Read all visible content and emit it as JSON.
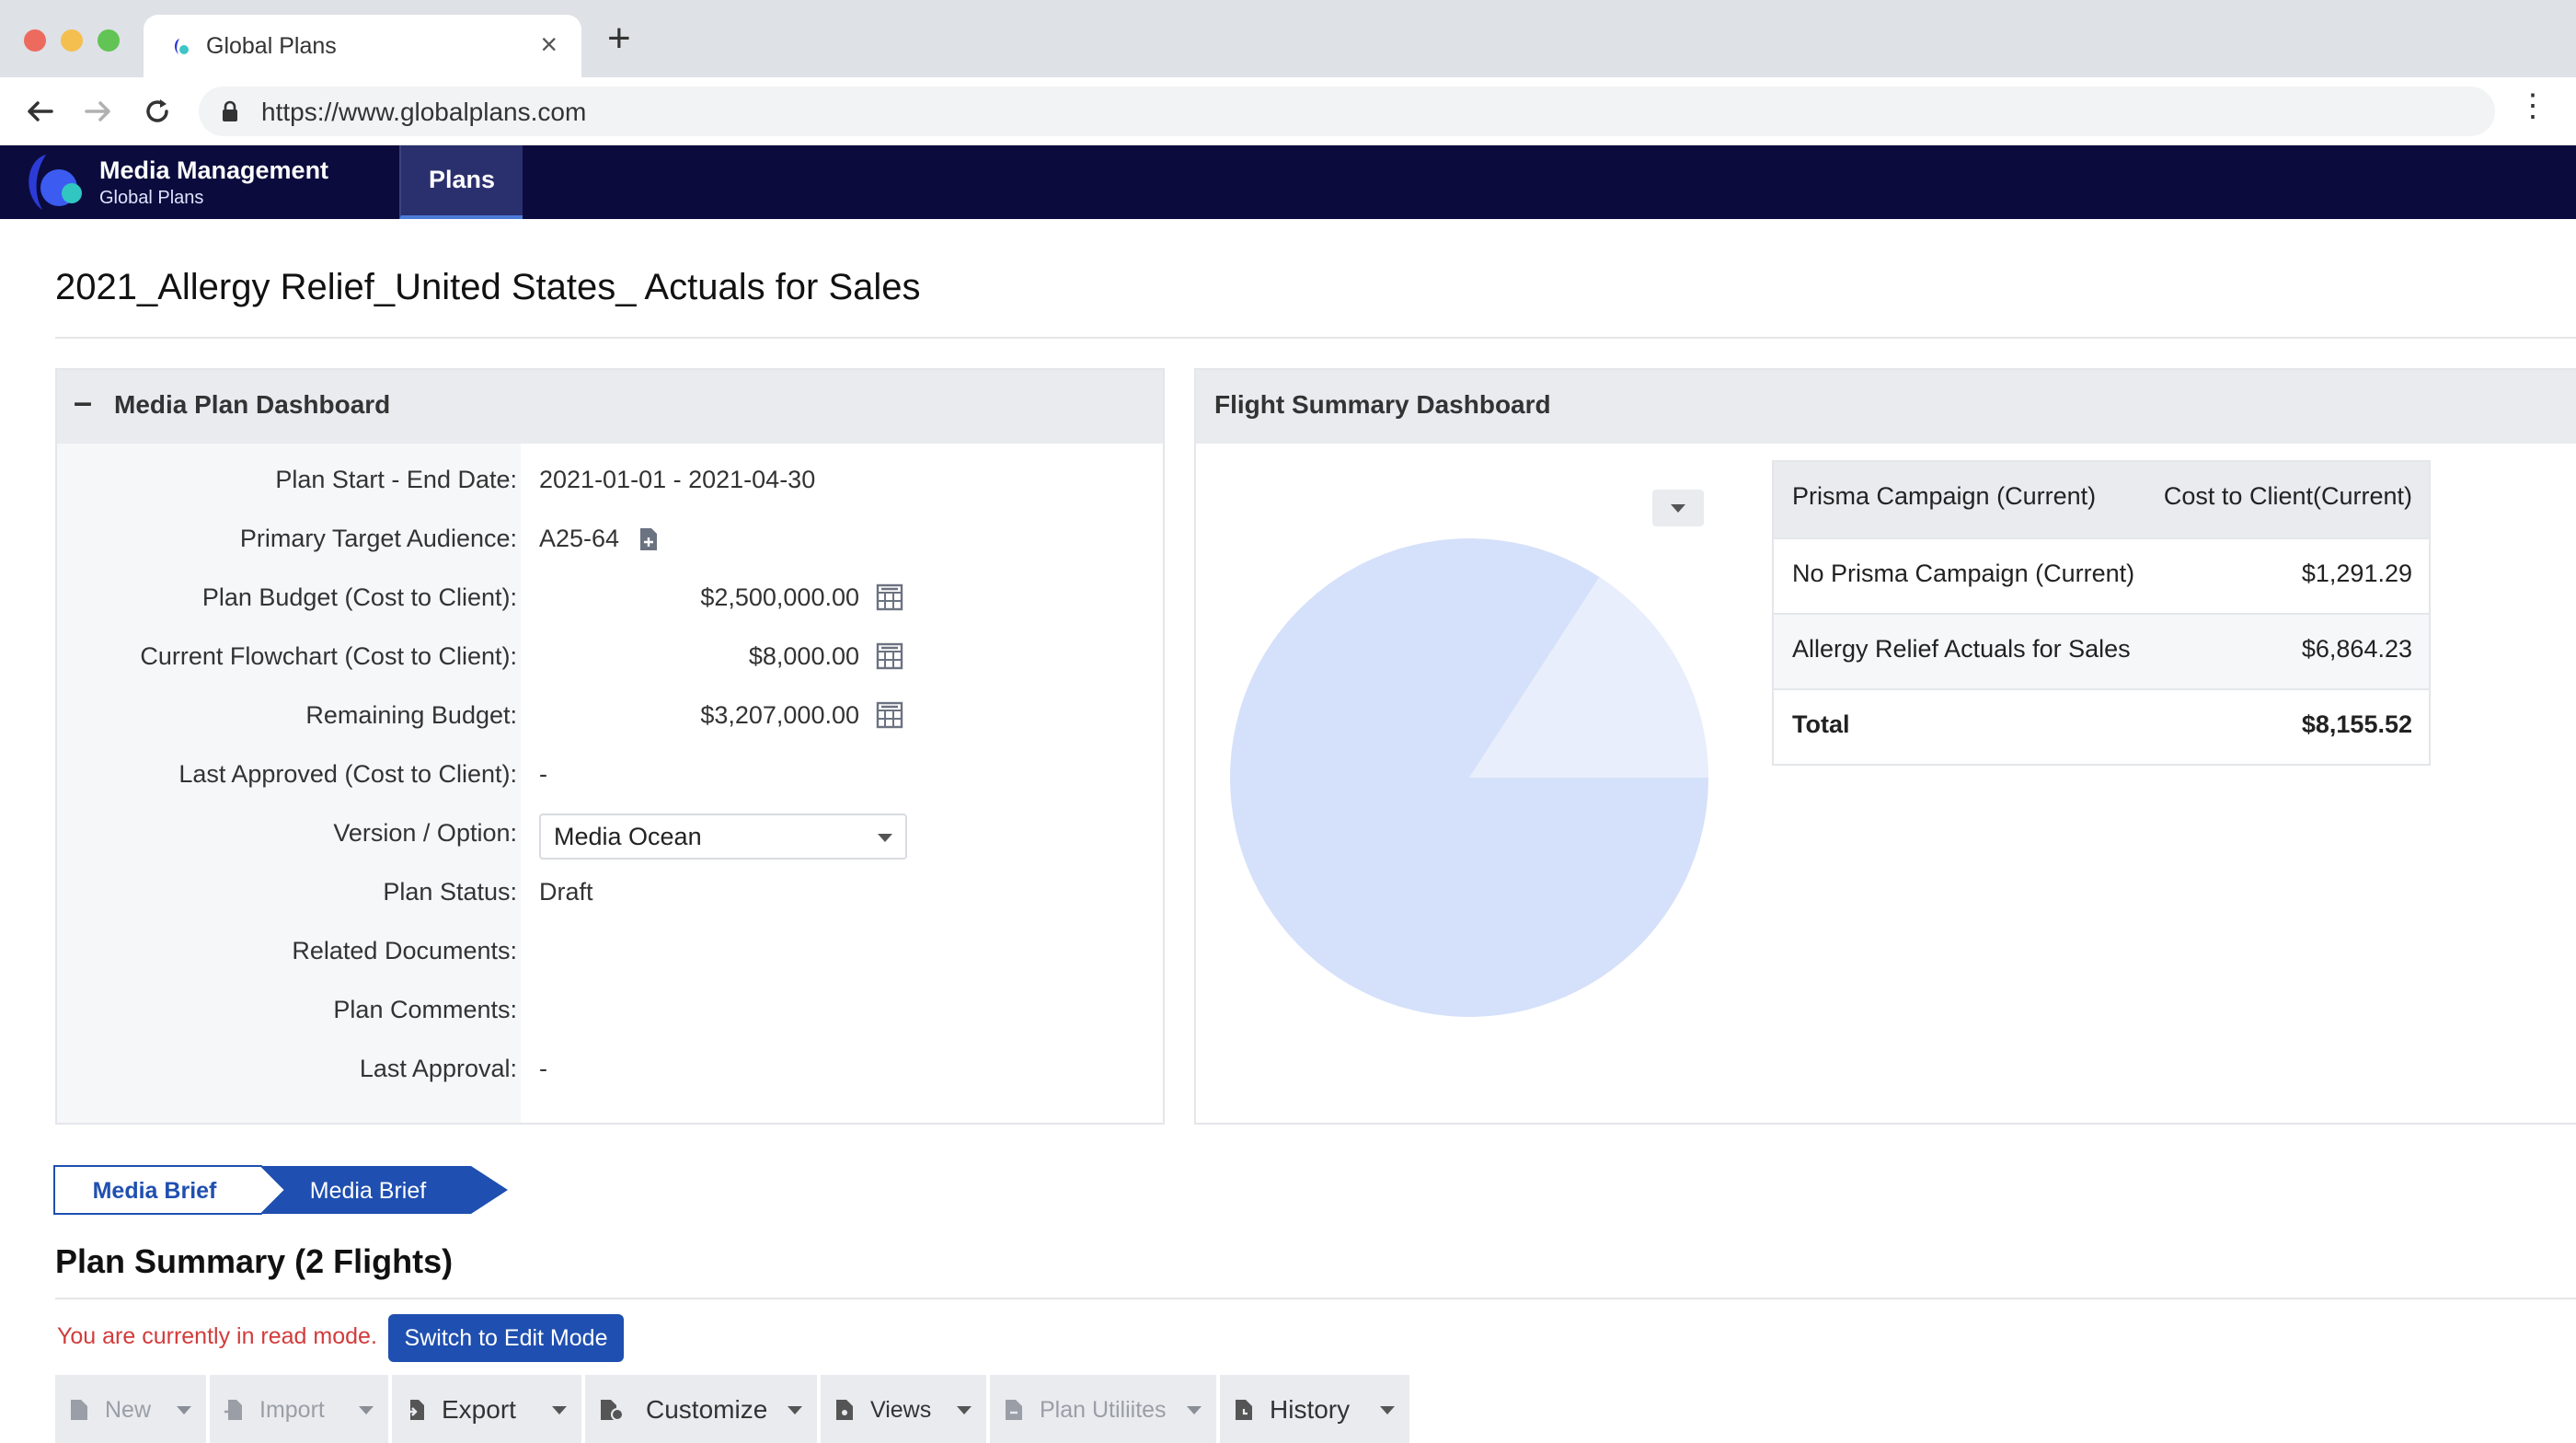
{
  "browser": {
    "tab_title": "Global Plans",
    "url": "https://www.globalplans.com"
  },
  "app": {
    "title": "Media Management",
    "subtitle": "Global Plans",
    "nav_tab": "Plans",
    "colors": {
      "header_bg": "#0b0c3d",
      "primary": "#1f4fb0",
      "pie_a": "#d5e1fa",
      "pie_b": "#e8eefb"
    }
  },
  "page": {
    "title": "2021_Allergy Relief_United States_ Actuals for Sales"
  },
  "media_plan": {
    "header": "Media Plan Dashboard",
    "rows": [
      {
        "label": "Plan Start - End Date:",
        "value": "2021-01-01 - 2021-04-30"
      },
      {
        "label": "Primary Target Audience:",
        "value": "A25-64"
      },
      {
        "label": "Plan Budget (Cost to Client):",
        "value": "$2,500,000.00"
      },
      {
        "label": "Current Flowchart (Cost to Client):",
        "value": "$8,000.00"
      },
      {
        "label": "Remaining Budget:",
        "value": "$3,207,000.00"
      },
      {
        "label": "Last Approved (Cost to Client):",
        "value": "-"
      },
      {
        "label": "Version / Option:",
        "value": "Media Ocean"
      },
      {
        "label": "Plan Status:",
        "value": "Draft"
      },
      {
        "label": "Related Documents:",
        "value": ""
      },
      {
        "label": "Plan Comments:",
        "value": ""
      },
      {
        "label": "Last Approval:",
        "value": "-"
      }
    ]
  },
  "flight_summary": {
    "header": "Flight Summary Dashboard",
    "table": {
      "columns": [
        "Prisma Campaign (Current)",
        "Cost to Client(Current)"
      ],
      "rows": [
        {
          "campaign": "No Prisma Campaign (Current)",
          "cost": "$1,291.29"
        },
        {
          "campaign": "Allergy Relief Actuals for Sales",
          "cost": "$6,864.23"
        }
      ],
      "total_label": "Total",
      "total_value": "$8,155.52"
    }
  },
  "chart_data": {
    "type": "pie",
    "slices": [
      {
        "label": "Allergy Relief Actuals for Sales",
        "value": 6864.23,
        "color": "#d5e1fa"
      },
      {
        "label": "No Prisma Campaign (Current)",
        "value": 1291.29,
        "color": "#e8eefb"
      }
    ]
  },
  "breadcrumbs": [
    "Media Brief",
    "Media Brief"
  ],
  "plan_summary": {
    "title": "Plan Summary (2 Flights)",
    "read_mode_text": "You are currently in read mode.",
    "edit_button": "Switch to Edit Mode"
  },
  "toolbar": {
    "new": "New",
    "import": "Import",
    "export": "Export",
    "customize": "Customize",
    "views": "Views",
    "plan_utilities": "Plan Utiliites",
    "history": "History"
  }
}
